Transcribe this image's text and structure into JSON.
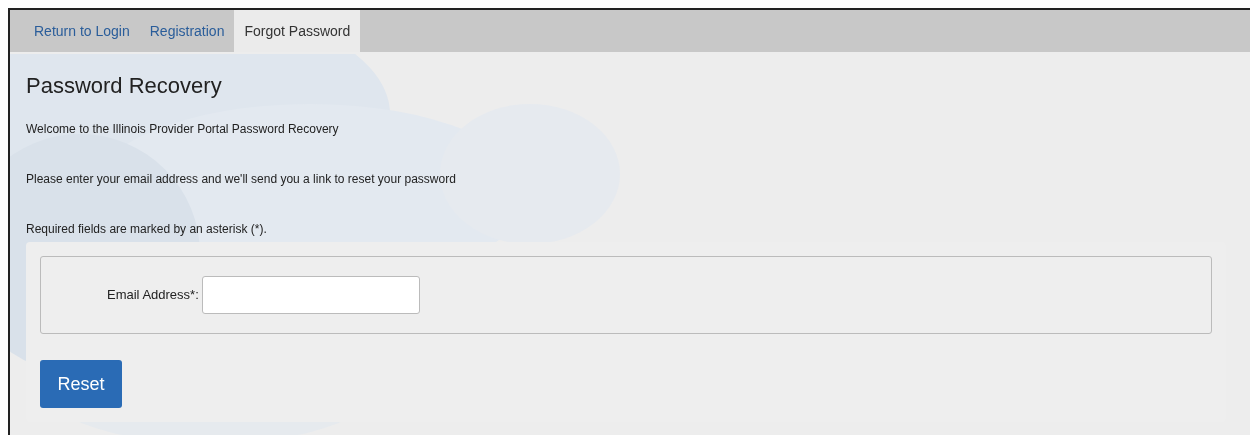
{
  "tabs": [
    {
      "label": "Return to Login",
      "selected": false
    },
    {
      "label": "Registration",
      "selected": false
    },
    {
      "label": "Forgot Password",
      "selected": true
    }
  ],
  "title": "Password Recovery",
  "paragraphs": [
    "Welcome to the Illinois Provider Portal Password Recovery",
    "Please enter your email address and we'll send you a link to reset your password",
    "Required fields are marked by an asterisk (*)."
  ],
  "form": {
    "fields": [
      {
        "label": "Email Address*:"
      }
    ]
  },
  "buttons": [
    "Reset"
  ]
}
